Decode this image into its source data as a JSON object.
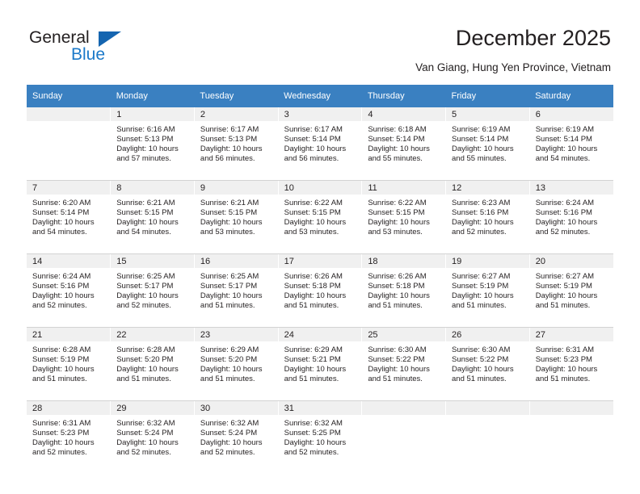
{
  "brand": {
    "name_part1": "General",
    "name_part2": "Blue"
  },
  "header": {
    "title": "December 2025",
    "subtitle": "Van Giang, Hung Yen Province, Vietnam"
  },
  "colors": {
    "header_band": "#3a80c1",
    "daynum_band": "#f0f0f0",
    "brand_blue": "#1b79c9",
    "logo_triangle": "#1565b0",
    "text": "#231f20"
  },
  "weekdays": [
    "Sunday",
    "Monday",
    "Tuesday",
    "Wednesday",
    "Thursday",
    "Friday",
    "Saturday"
  ],
  "weeks": [
    [
      {
        "day": "",
        "sunrise": "",
        "sunset": "",
        "daylight": "",
        "empty": true
      },
      {
        "day": "1",
        "sunrise": "Sunrise: 6:16 AM",
        "sunset": "Sunset: 5:13 PM",
        "daylight": "Daylight: 10 hours and 57 minutes."
      },
      {
        "day": "2",
        "sunrise": "Sunrise: 6:17 AM",
        "sunset": "Sunset: 5:13 PM",
        "daylight": "Daylight: 10 hours and 56 minutes."
      },
      {
        "day": "3",
        "sunrise": "Sunrise: 6:17 AM",
        "sunset": "Sunset: 5:14 PM",
        "daylight": "Daylight: 10 hours and 56 minutes."
      },
      {
        "day": "4",
        "sunrise": "Sunrise: 6:18 AM",
        "sunset": "Sunset: 5:14 PM",
        "daylight": "Daylight: 10 hours and 55 minutes."
      },
      {
        "day": "5",
        "sunrise": "Sunrise: 6:19 AM",
        "sunset": "Sunset: 5:14 PM",
        "daylight": "Daylight: 10 hours and 55 minutes."
      },
      {
        "day": "6",
        "sunrise": "Sunrise: 6:19 AM",
        "sunset": "Sunset: 5:14 PM",
        "daylight": "Daylight: 10 hours and 54 minutes."
      }
    ],
    [
      {
        "day": "7",
        "sunrise": "Sunrise: 6:20 AM",
        "sunset": "Sunset: 5:14 PM",
        "daylight": "Daylight: 10 hours and 54 minutes."
      },
      {
        "day": "8",
        "sunrise": "Sunrise: 6:21 AM",
        "sunset": "Sunset: 5:15 PM",
        "daylight": "Daylight: 10 hours and 54 minutes."
      },
      {
        "day": "9",
        "sunrise": "Sunrise: 6:21 AM",
        "sunset": "Sunset: 5:15 PM",
        "daylight": "Daylight: 10 hours and 53 minutes."
      },
      {
        "day": "10",
        "sunrise": "Sunrise: 6:22 AM",
        "sunset": "Sunset: 5:15 PM",
        "daylight": "Daylight: 10 hours and 53 minutes."
      },
      {
        "day": "11",
        "sunrise": "Sunrise: 6:22 AM",
        "sunset": "Sunset: 5:15 PM",
        "daylight": "Daylight: 10 hours and 53 minutes."
      },
      {
        "day": "12",
        "sunrise": "Sunrise: 6:23 AM",
        "sunset": "Sunset: 5:16 PM",
        "daylight": "Daylight: 10 hours and 52 minutes."
      },
      {
        "day": "13",
        "sunrise": "Sunrise: 6:24 AM",
        "sunset": "Sunset: 5:16 PM",
        "daylight": "Daylight: 10 hours and 52 minutes."
      }
    ],
    [
      {
        "day": "14",
        "sunrise": "Sunrise: 6:24 AM",
        "sunset": "Sunset: 5:16 PM",
        "daylight": "Daylight: 10 hours and 52 minutes."
      },
      {
        "day": "15",
        "sunrise": "Sunrise: 6:25 AM",
        "sunset": "Sunset: 5:17 PM",
        "daylight": "Daylight: 10 hours and 52 minutes."
      },
      {
        "day": "16",
        "sunrise": "Sunrise: 6:25 AM",
        "sunset": "Sunset: 5:17 PM",
        "daylight": "Daylight: 10 hours and 51 minutes."
      },
      {
        "day": "17",
        "sunrise": "Sunrise: 6:26 AM",
        "sunset": "Sunset: 5:18 PM",
        "daylight": "Daylight: 10 hours and 51 minutes."
      },
      {
        "day": "18",
        "sunrise": "Sunrise: 6:26 AM",
        "sunset": "Sunset: 5:18 PM",
        "daylight": "Daylight: 10 hours and 51 minutes."
      },
      {
        "day": "19",
        "sunrise": "Sunrise: 6:27 AM",
        "sunset": "Sunset: 5:19 PM",
        "daylight": "Daylight: 10 hours and 51 minutes."
      },
      {
        "day": "20",
        "sunrise": "Sunrise: 6:27 AM",
        "sunset": "Sunset: 5:19 PM",
        "daylight": "Daylight: 10 hours and 51 minutes."
      }
    ],
    [
      {
        "day": "21",
        "sunrise": "Sunrise: 6:28 AM",
        "sunset": "Sunset: 5:19 PM",
        "daylight": "Daylight: 10 hours and 51 minutes."
      },
      {
        "day": "22",
        "sunrise": "Sunrise: 6:28 AM",
        "sunset": "Sunset: 5:20 PM",
        "daylight": "Daylight: 10 hours and 51 minutes."
      },
      {
        "day": "23",
        "sunrise": "Sunrise: 6:29 AM",
        "sunset": "Sunset: 5:20 PM",
        "daylight": "Daylight: 10 hours and 51 minutes."
      },
      {
        "day": "24",
        "sunrise": "Sunrise: 6:29 AM",
        "sunset": "Sunset: 5:21 PM",
        "daylight": "Daylight: 10 hours and 51 minutes."
      },
      {
        "day": "25",
        "sunrise": "Sunrise: 6:30 AM",
        "sunset": "Sunset: 5:22 PM",
        "daylight": "Daylight: 10 hours and 51 minutes."
      },
      {
        "day": "26",
        "sunrise": "Sunrise: 6:30 AM",
        "sunset": "Sunset: 5:22 PM",
        "daylight": "Daylight: 10 hours and 51 minutes."
      },
      {
        "day": "27",
        "sunrise": "Sunrise: 6:31 AM",
        "sunset": "Sunset: 5:23 PM",
        "daylight": "Daylight: 10 hours and 51 minutes."
      }
    ],
    [
      {
        "day": "28",
        "sunrise": "Sunrise: 6:31 AM",
        "sunset": "Sunset: 5:23 PM",
        "daylight": "Daylight: 10 hours and 52 minutes."
      },
      {
        "day": "29",
        "sunrise": "Sunrise: 6:32 AM",
        "sunset": "Sunset: 5:24 PM",
        "daylight": "Daylight: 10 hours and 52 minutes."
      },
      {
        "day": "30",
        "sunrise": "Sunrise: 6:32 AM",
        "sunset": "Sunset: 5:24 PM",
        "daylight": "Daylight: 10 hours and 52 minutes."
      },
      {
        "day": "31",
        "sunrise": "Sunrise: 6:32 AM",
        "sunset": "Sunset: 5:25 PM",
        "daylight": "Daylight: 10 hours and 52 minutes."
      },
      {
        "day": "",
        "sunrise": "",
        "sunset": "",
        "daylight": "",
        "empty": true
      },
      {
        "day": "",
        "sunrise": "",
        "sunset": "",
        "daylight": "",
        "empty": true
      },
      {
        "day": "",
        "sunrise": "",
        "sunset": "",
        "daylight": "",
        "empty": true
      }
    ]
  ]
}
